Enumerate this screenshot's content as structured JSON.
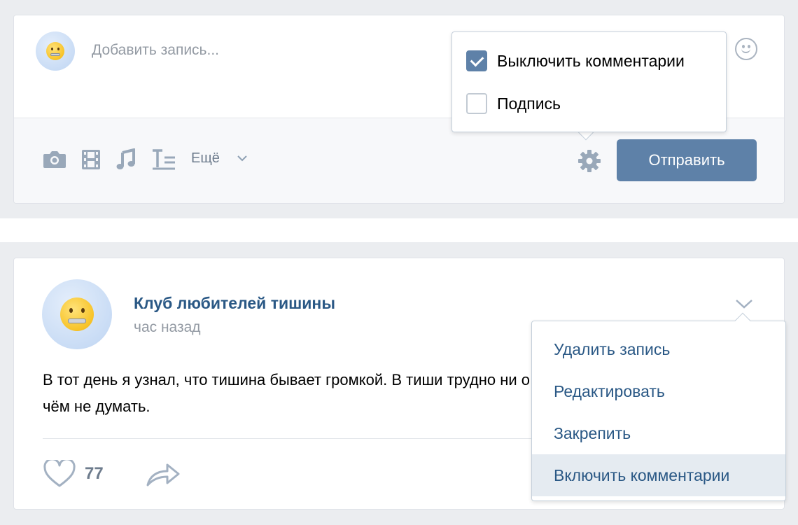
{
  "composer": {
    "placeholder": "Добавить запись...",
    "tools": [
      {
        "icon": "camera-icon"
      },
      {
        "icon": "video-icon"
      },
      {
        "icon": "music-icon"
      },
      {
        "icon": "text-format-icon"
      }
    ],
    "more_label": "Ещё",
    "send_label": "Отправить",
    "accent_color": "#5e81a8"
  },
  "settings_popup": {
    "options": [
      {
        "label": "Выключить комментарии",
        "checked": true
      },
      {
        "label": "Подпись",
        "checked": false
      }
    ]
  },
  "post": {
    "author": "Клуб любителей тишины",
    "time": "час назад",
    "text": "В тот день я узнал, что тишина бывает громкой. В тиши трудно ни о чём не думать.",
    "likes": "77"
  },
  "post_menu": {
    "items": [
      {
        "label": "Удалить запись"
      },
      {
        "label": "Редактировать"
      },
      {
        "label": "Закрепить"
      },
      {
        "label": "Включить комментарии",
        "highlighted": true
      }
    ]
  }
}
